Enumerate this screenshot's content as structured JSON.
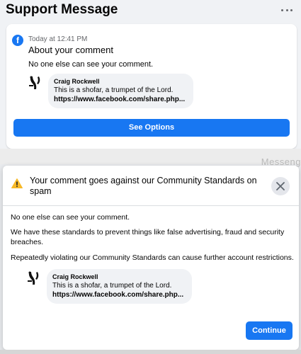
{
  "header": {
    "title": "Support Message"
  },
  "notification": {
    "timestamp": "Today at 12:41 PM",
    "title": "About your comment",
    "description": "No one else can see your comment.",
    "see_options_label": "See Options"
  },
  "comment": {
    "author": "Craig Rockwell",
    "text": "This is a shofar, a trumpet of the Lord.",
    "link": "https://www.facebook.com/share.php..."
  },
  "background_text": "Messeng",
  "modal": {
    "title": "Your comment goes against our Community Standards on spam",
    "para1": "No one else can see your comment.",
    "para2": "We have these standards to prevent things like false advertising, fraud and security breaches.",
    "para3": "Repeatedly violating our Community Standards can cause further account restrictions.",
    "continue_label": "Continue"
  },
  "colors": {
    "accent": "#1877f2",
    "warning": "#f7b928",
    "bubble": "#f0f2f5"
  }
}
